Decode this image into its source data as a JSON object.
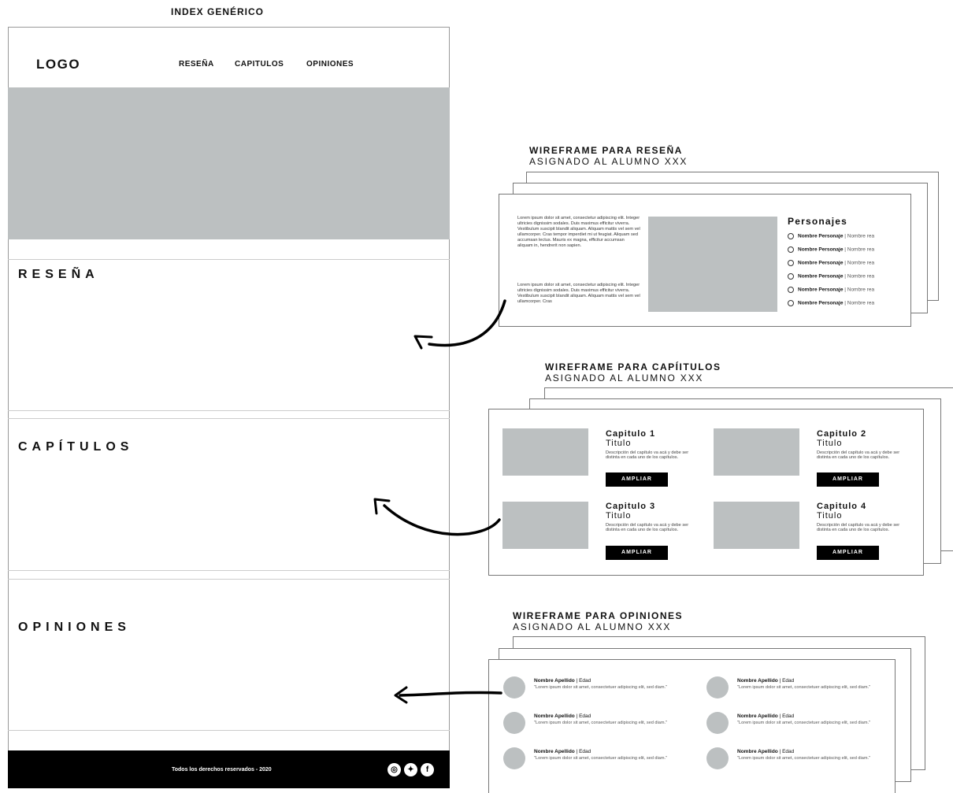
{
  "index": {
    "page_label": "INDEX GENÉRICO",
    "logo": "LOGO",
    "nav": [
      "RESEÑA",
      "CAPITULOS",
      "OPINIONES"
    ],
    "sections": [
      "RESEÑA",
      "CAPÍTULOS",
      "OPINIONES"
    ],
    "footer": "Todos los derechos reservados - 2020",
    "social": [
      "instagram-icon",
      "twitter-icon",
      "facebook-icon"
    ]
  },
  "resena_wf": {
    "title": "WIREFRAME PARA RESEÑA",
    "subtitle": "ASIGNADO AL ALUMNO XXX",
    "paragraph1": "Lorem ipsum dolor sit amet, consectetur adipiscing elit. Integer ultricies dignissim sodales. Duis maximus efficitur viverra. Vestibulum suscipit blandit aliquam. Aliquam mattis vel sem vel ullamcorper. Cras tempor imperdiet mi ut feugiat. Aliquam sed accumsan lectus. Mauris ex magna, efficitur accumsan aliquam in, hendrerit non sapien.",
    "paragraph2": "Lorem ipsum dolor sit amet, consectetur adipiscing elit. Integer ultricies dignissim sodales. Duis maximus efficitur viverra. Vestibulum suscipit blandit aliquam. Aliquam mattis vel sem vel ullamcorper. Cras",
    "personajes_title": "Personajes",
    "personaje_name": "Nombre Personaje",
    "personaje_real": "Nombre rea"
  },
  "capitulos_wf": {
    "title": "WIREFRAME PARA CAPÍITULOS",
    "subtitle": "ASIGNADO AL ALUMNO XXX",
    "items": [
      {
        "num": "Capitulo 1",
        "tit": "Titulo",
        "desc": "Descripción del capítulo va acá y debe ser distinta en cada uno de los capítulos.",
        "btn": "AMPLIAR"
      },
      {
        "num": "Capitulo 2",
        "tit": "Titulo",
        "desc": "Descripción del capítulo va acá y debe ser distinta en cada uno de los capítulos.",
        "btn": "AMPLIAR"
      },
      {
        "num": "Capitulo 3",
        "tit": "Titulo",
        "desc": "Descripción del capítulo va acá y debe ser distinta en cada uno de los capítulos.",
        "btn": "AMPLIAR"
      },
      {
        "num": "Capitulo 4",
        "tit": "Titulo",
        "desc": "Descripción del capítulo va acá y debe ser distinta en cada uno de los capítulos.",
        "btn": "AMPLIAR"
      }
    ]
  },
  "opiniones_wf": {
    "title": "WIREFRAME PARA OPINIONES",
    "subtitle": "ASIGNADO AL ALUMNO XXX",
    "name": "Nombre Apellido",
    "age": "| Edad",
    "quote": "\"Lorem ipsum dolor sit amet, consectetuer adipiscing elit, sed diam.\""
  }
}
